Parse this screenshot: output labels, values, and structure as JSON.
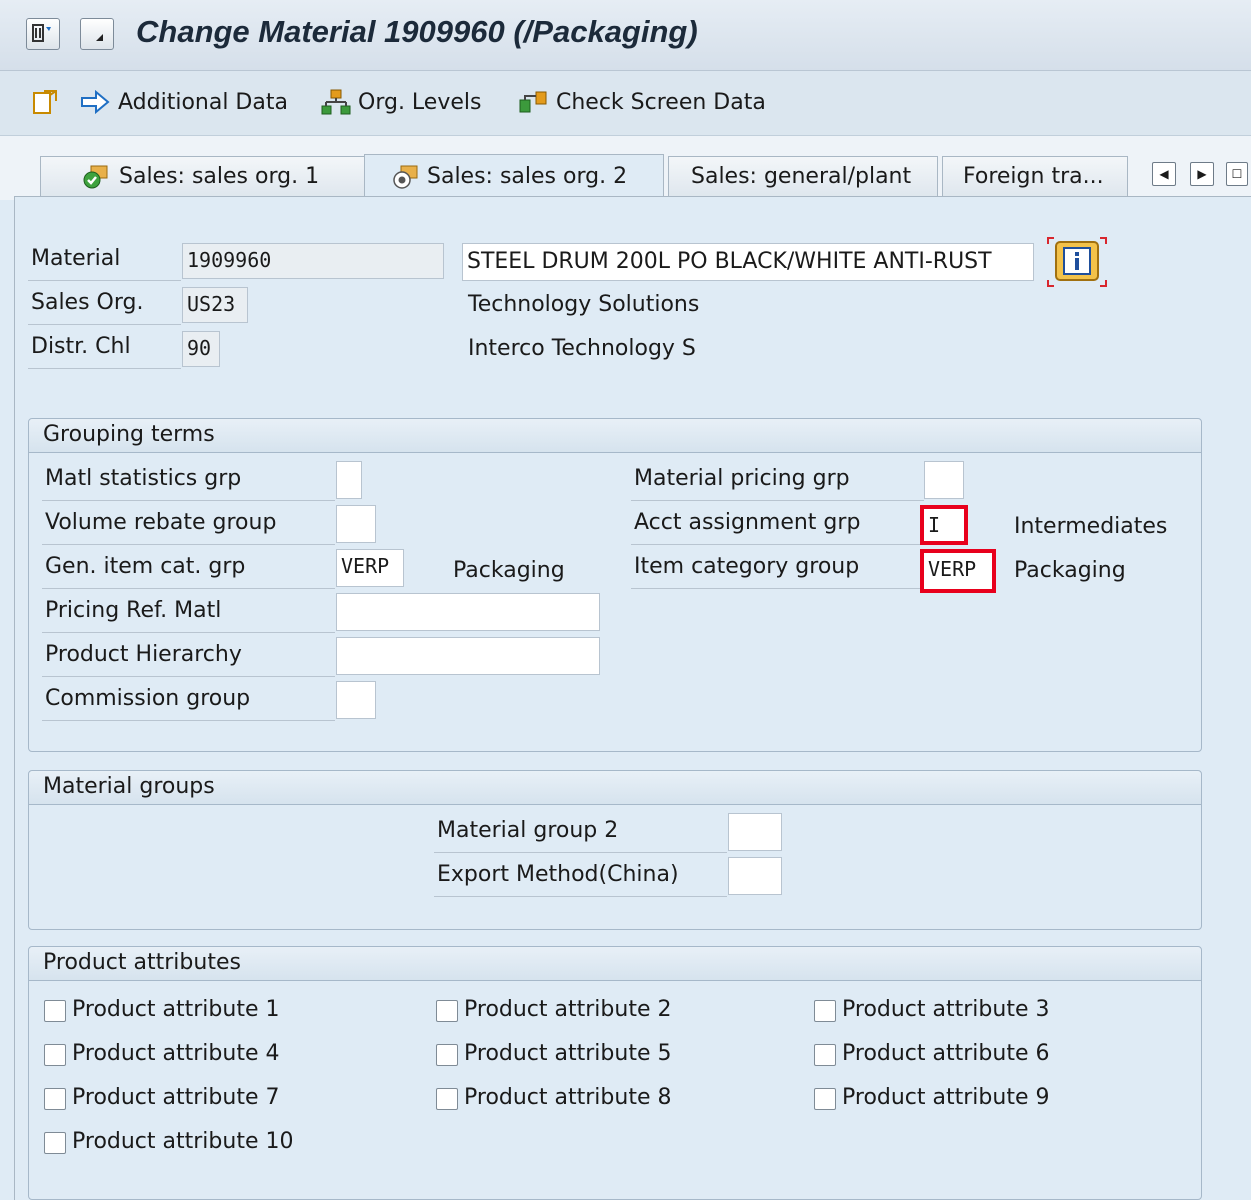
{
  "title": "Change Material 1909960 (/Packaging)",
  "toolbar": {
    "additional_data": "Additional Data",
    "org_levels": "Org. Levels",
    "check_screen_data": "Check Screen Data"
  },
  "tabs": [
    {
      "label": "Sales: sales org. 1"
    },
    {
      "label": "Sales: sales org. 2"
    },
    {
      "label": "Sales: general/plant"
    },
    {
      "label": "Foreign tra..."
    }
  ],
  "header": {
    "material_label": "Material",
    "material_value": "1909960",
    "material_desc": "STEEL DRUM 200L PO BLACK/WHITE ANTI-RUST",
    "sales_org_label": "Sales Org.",
    "sales_org_value": "US23",
    "sales_org_desc": "Technology Solutions",
    "distr_chl_label": "Distr. Chl",
    "distr_chl_value": "90",
    "distr_chl_desc": "Interco Technology S"
  },
  "grouping": {
    "title": "Grouping terms",
    "matl_stat_label": "Matl statistics grp",
    "matl_stat_value": "",
    "volume_rebate_label": "Volume rebate group",
    "volume_rebate_value": "",
    "gen_item_label": "Gen. item cat. grp",
    "gen_item_value": "VERP",
    "gen_item_desc": "Packaging",
    "pricing_ref_label": "Pricing Ref. Matl",
    "pricing_ref_value": "",
    "product_hier_label": "Product Hierarchy",
    "product_hier_value": "",
    "commission_label": "Commission group",
    "commission_value": "",
    "mat_pricing_label": "Material pricing grp",
    "mat_pricing_value": "",
    "acct_assign_label": "Acct assignment grp",
    "acct_assign_value": "I",
    "acct_assign_desc": "Intermediates",
    "item_cat_label": "Item category group",
    "item_cat_value": "VERP",
    "item_cat_desc": "Packaging"
  },
  "material_groups": {
    "title": "Material groups",
    "group2_label": "Material group 2",
    "group2_value": "",
    "export_label": "Export Method(China)",
    "export_value": ""
  },
  "product_attributes": {
    "title": "Product attributes",
    "items": [
      {
        "label": "Product attribute 1",
        "checked": false
      },
      {
        "label": "Product attribute 2",
        "checked": false
      },
      {
        "label": "Product attribute 3",
        "checked": false
      },
      {
        "label": "Product attribute 4",
        "checked": false
      },
      {
        "label": "Product attribute 5",
        "checked": false
      },
      {
        "label": "Product attribute 6",
        "checked": false
      },
      {
        "label": "Product attribute 7",
        "checked": false
      },
      {
        "label": "Product attribute 8",
        "checked": false
      },
      {
        "label": "Product attribute 9",
        "checked": false
      },
      {
        "label": "Product attribute 10",
        "checked": false
      }
    ]
  },
  "colors": {
    "highlight": "#e8001c",
    "background": "#dfebf5"
  }
}
